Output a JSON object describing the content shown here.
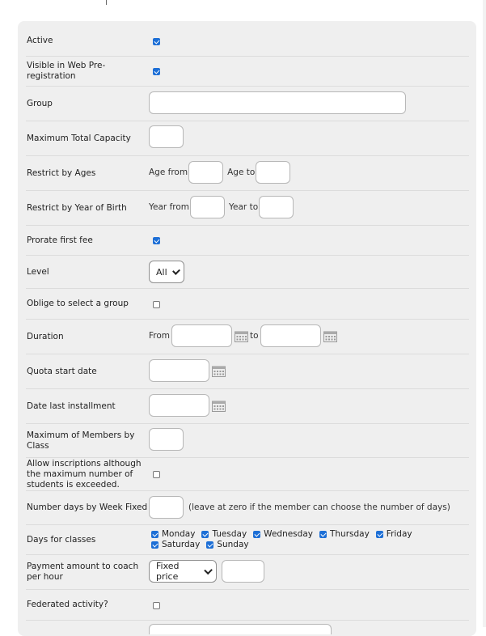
{
  "form": {
    "active": {
      "label": "Active",
      "checked": true
    },
    "visible_web": {
      "label": "Visible in Web Pre-registration",
      "checked": true
    },
    "group": {
      "label": "Group",
      "value": ""
    },
    "max_capacity": {
      "label": "Maximum Total Capacity",
      "value": ""
    },
    "restrict_ages": {
      "label": "Restrict by Ages",
      "from_label": "Age from",
      "to_label": "Age to",
      "from_value": "",
      "to_value": ""
    },
    "restrict_year": {
      "label": "Restrict by Year of Birth",
      "from_label": "Year from",
      "to_label": "Year to",
      "from_value": "",
      "to_value": ""
    },
    "prorate": {
      "label": "Prorate first fee",
      "checked": true
    },
    "level": {
      "label": "Level",
      "selected": "All"
    },
    "oblige_group": {
      "label": "Oblige to select a group",
      "checked": false
    },
    "duration": {
      "label": "Duration",
      "from_label": "From",
      "to_label": "to",
      "from_value": "",
      "to_value": ""
    },
    "quota_start": {
      "label": "Quota start date",
      "value": ""
    },
    "date_last_installment": {
      "label": "Date last installment",
      "value": ""
    },
    "max_members_class": {
      "label": "Maximum of Members by Class",
      "value": ""
    },
    "allow_inscriptions": {
      "label": "Allow inscriptions although the maximum number of students is exceeded.",
      "checked": false
    },
    "days_week_fixed": {
      "label": "Number days by Week Fixed",
      "value": "",
      "hint": "(leave at zero if the member can choose the number of days)"
    },
    "days_classes": {
      "label": "Days for classes",
      "days": [
        {
          "name": "Monday",
          "checked": true
        },
        {
          "name": "Tuesday",
          "checked": true
        },
        {
          "name": "Wednesday",
          "checked": true
        },
        {
          "name": "Thursday",
          "checked": true
        },
        {
          "name": "Friday",
          "checked": true
        },
        {
          "name": "Saturday",
          "checked": true
        },
        {
          "name": "Sunday",
          "checked": true
        }
      ]
    },
    "payment_coach": {
      "label": "Payment amount to coach per hour",
      "selected": "Fixed price",
      "value": ""
    },
    "federated": {
      "label": "Federated activity?",
      "checked": false
    }
  },
  "colors": {
    "checkbox_accent": "#1d6fd6",
    "panel_bg": "#efefef"
  },
  "icons": {
    "calendar": "calendar-icon",
    "dropdown": "chevron-down-icon"
  }
}
